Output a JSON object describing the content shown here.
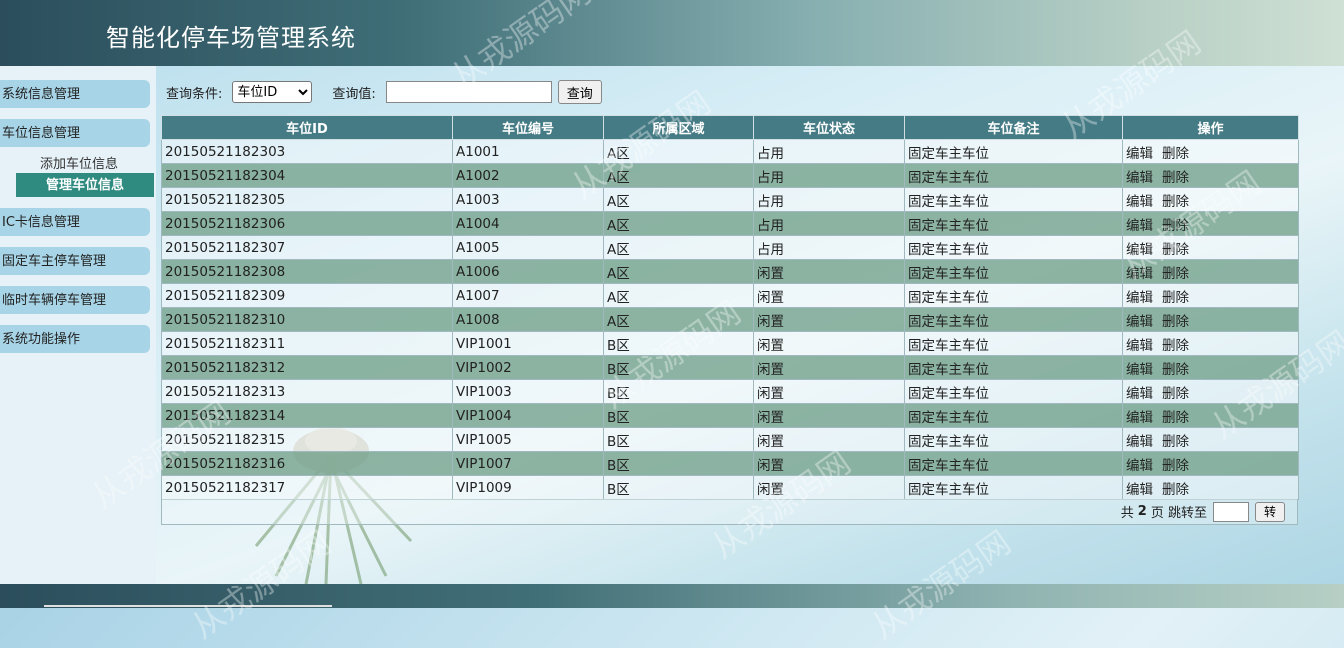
{
  "header": {
    "title": "智能化停车场管理系统"
  },
  "sidebar": {
    "items": [
      {
        "label": "系统信息管理"
      },
      {
        "label": "车位信息管理"
      },
      {
        "label": "IC卡信息管理"
      },
      {
        "label": "固定车主停车管理"
      },
      {
        "label": "临时车辆停车管理"
      },
      {
        "label": "系统功能操作"
      }
    ],
    "sub_items": [
      {
        "label": "添加车位信息"
      },
      {
        "label": "管理车位信息"
      }
    ]
  },
  "search": {
    "condition_label": "查询条件:",
    "condition_selected": "车位ID",
    "value_label": "查询值:",
    "value": "",
    "button_label": "查询"
  },
  "table": {
    "columns": [
      "车位ID",
      "车位编号",
      "所属区域",
      "车位状态",
      "车位备注",
      "操作"
    ],
    "rows": [
      [
        "20150521182303",
        "A1001",
        "A区",
        "占用",
        "固定车主车位"
      ],
      [
        "20150521182304",
        "A1002",
        "A区",
        "占用",
        "固定车主车位"
      ],
      [
        "20150521182305",
        "A1003",
        "A区",
        "占用",
        "固定车主车位"
      ],
      [
        "20150521182306",
        "A1004",
        "A区",
        "占用",
        "固定车主车位"
      ],
      [
        "20150521182307",
        "A1005",
        "A区",
        "占用",
        "固定车主车位"
      ],
      [
        "20150521182308",
        "A1006",
        "A区",
        "闲置",
        "固定车主车位"
      ],
      [
        "20150521182309",
        "A1007",
        "A区",
        "闲置",
        "固定车主车位"
      ],
      [
        "20150521182310",
        "A1008",
        "A区",
        "闲置",
        "固定车主车位"
      ],
      [
        "20150521182311",
        "VIP1001",
        "B区",
        "闲置",
        "固定车主车位"
      ],
      [
        "20150521182312",
        "VIP1002",
        "B区",
        "闲置",
        "固定车主车位"
      ],
      [
        "20150521182313",
        "VIP1003",
        "B区",
        "闲置",
        "固定车主车位"
      ],
      [
        "20150521182314",
        "VIP1004",
        "B区",
        "闲置",
        "固定车主车位"
      ],
      [
        "20150521182315",
        "VIP1005",
        "B区",
        "闲置",
        "固定车主车位"
      ],
      [
        "20150521182316",
        "VIP1007",
        "B区",
        "闲置",
        "固定车主车位"
      ],
      [
        "20150521182317",
        "VIP1009",
        "B区",
        "闲置",
        "固定车主车位"
      ]
    ],
    "edit_label": "编辑",
    "delete_label": "删除"
  },
  "pagination": {
    "prefix": "共",
    "total_pages": "2",
    "suffix": "页 跳转至",
    "go_label": "转"
  },
  "watermark": "从戎源码网"
}
